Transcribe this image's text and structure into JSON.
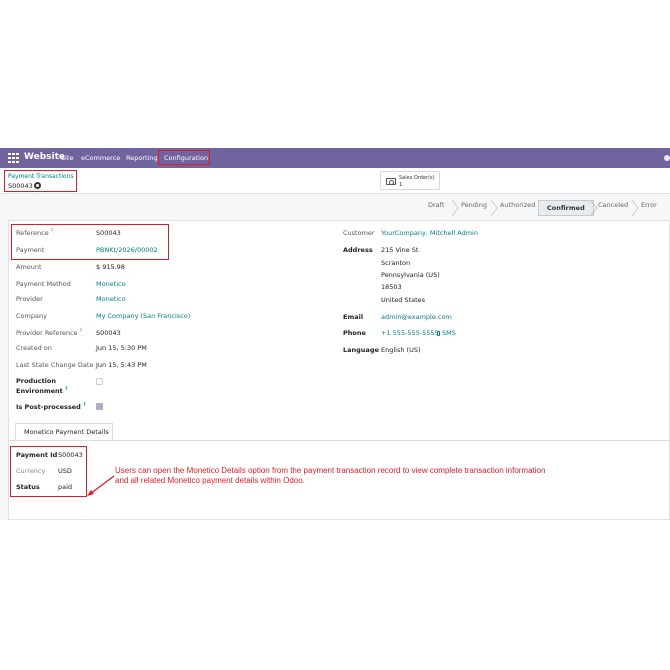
{
  "navbar": {
    "app_name": "Website",
    "menu": [
      "Site",
      "eCommerce",
      "Reporting",
      "Configuration"
    ]
  },
  "breadcrumb": {
    "parent": "Payment Transactions",
    "current": "S00043"
  },
  "smart_button": {
    "label": "Sales Order(s)",
    "count": "1"
  },
  "statusbar": {
    "stages": [
      "Draft",
      "Pending",
      "Authorized",
      "Confirmed",
      "Canceled",
      "Error"
    ],
    "active": "Confirmed"
  },
  "left_fields": [
    {
      "label": "Reference",
      "help": "?",
      "value": "S00043"
    },
    {
      "label": "Payment",
      "value": "PBNKt/2026/00002"
    },
    {
      "label": "Amount",
      "value": "$ 915.98"
    },
    {
      "label": "Payment Method",
      "value": "Monetico"
    },
    {
      "label": "Provider",
      "value": "Monetico"
    },
    {
      "label": "Company",
      "value": "My Company (San Francisco)"
    },
    {
      "label": "Provider Reference",
      "help": "?",
      "value": "S00043"
    },
    {
      "label": "Created on",
      "value": "Jun 15, 5:30 PM"
    },
    {
      "label": "Last State Change Date",
      "value": "Jun 15, 5:43 PM"
    },
    {
      "label": "Production",
      "label2": "Environment",
      "help": "?",
      "checked": false
    },
    {
      "label": "Is Post-processed",
      "help": "?",
      "checked": true
    }
  ],
  "right_fields": {
    "customer_label": "Customer",
    "customer": "YourCompany, Mitchell Admin",
    "address_label": "Address",
    "address": [
      "215 Vine St",
      "Scranton",
      "Pennsylvania (US)",
      "18503",
      "United States"
    ],
    "email_label": "Email",
    "email": "admin@example.com",
    "phone_label": "Phone",
    "phone": "+1 555-555-5555",
    "sms": "SMS",
    "language_label": "Language",
    "language": "English (US)"
  },
  "tab": {
    "label": "Monetico Payment Details"
  },
  "details": {
    "payment_id_label": "Payment Id",
    "payment_id": "S00043",
    "currency_label": "Currency",
    "currency": "USD",
    "status_label": "Status",
    "status": "paid"
  },
  "annotation": "Users can open the Monetico Details option from the payment transaction record to view complete transaction information and all related Monetico payment details within Odoo.",
  "colors": {
    "navbar": "#71639e",
    "link": "#017e84",
    "highlight": "#e21b23"
  }
}
